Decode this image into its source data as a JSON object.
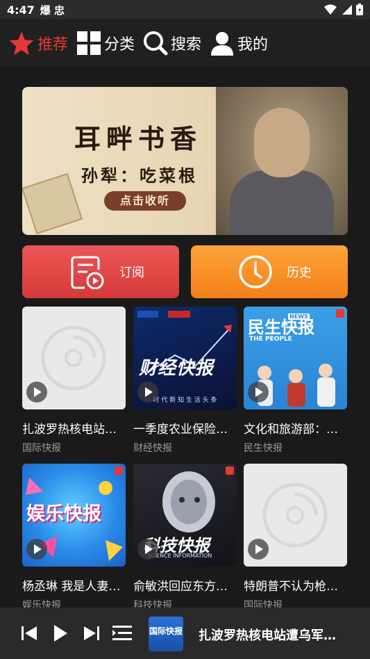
{
  "status": {
    "time": "4:47",
    "app_icons": "爆 忠"
  },
  "nav": {
    "items": [
      {
        "label": "推荐",
        "icon": "star-icon",
        "active": true
      },
      {
        "label": "分类",
        "icon": "grid-icon",
        "active": false
      },
      {
        "label": "搜索",
        "icon": "search-icon",
        "active": false
      },
      {
        "label": "我的",
        "icon": "user-icon",
        "active": false
      }
    ]
  },
  "banner": {
    "title": "耳畔书香",
    "subtitle": "孙犁：吃菜根",
    "button": "点击收听"
  },
  "actions": {
    "subscribe": "订阅",
    "history": "历史"
  },
  "cards": [
    {
      "title": "扎波罗热核电站…",
      "source": "国际快报",
      "thumb": "blank"
    },
    {
      "title": "一季度农业保险…",
      "source": "财经快报",
      "thumb": "finance",
      "thumb_text": "财经快报",
      "thumb_footer": "时 代 新 知  生 活 头 条"
    },
    {
      "title": "文化和旅游部：…",
      "source": "民生快报",
      "thumb": "people",
      "thumb_text": "民生快报",
      "thumb_sub": "THE PEOPLE",
      "thumb_news": "NEWS"
    },
    {
      "title": "杨丞琳 我是人妻…",
      "source": "娱乐快报",
      "thumb": "ent",
      "thumb_text": "娱乐快报"
    },
    {
      "title": "俞敏洪回应东方…",
      "source": "科技快报",
      "thumb": "tech",
      "thumb_text": "科技快报",
      "thumb_sub": "SCIENCE INFORMATION"
    },
    {
      "title": "特朗普不认为枪…",
      "source": "国际快报",
      "thumb": "blank"
    }
  ],
  "player": {
    "title": "扎波罗热核电站遭乌军…",
    "cover_text": "国际快报"
  },
  "colors": {
    "accent": "#e53935",
    "subscribe": "#e04848",
    "history": "#f7901e"
  }
}
